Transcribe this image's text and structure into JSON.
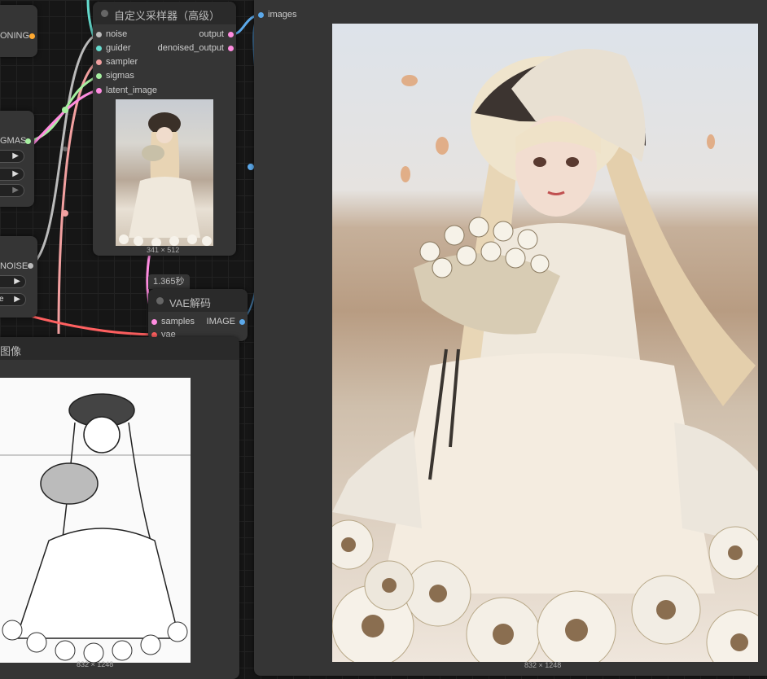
{
  "left_nodes": {
    "conditioning_out": "ONING",
    "sigmas_out": "GMAS",
    "noise_out": "NOISE",
    "widget_value": "e"
  },
  "sampler_node": {
    "title": "自定义采样器（高级）",
    "inputs": [
      "noise",
      "guider",
      "sampler",
      "sigmas",
      "latent_image"
    ],
    "outputs": [
      "output",
      "denoised_output"
    ],
    "preview_size": "341 × 512"
  },
  "vae_node": {
    "timing": "1.365秒",
    "title": "VAE解码",
    "input_samples": "samples",
    "input_vae": "vae",
    "output_image": "IMAGE"
  },
  "load_image_node": {
    "title": "图像",
    "image_size": "832 × 1248"
  },
  "preview_node": {
    "input_images": "images",
    "image_size": "832 × 1248"
  },
  "colors": {
    "guider": "#66ddd0",
    "sampler": "#f2a0a0",
    "sigmas": "#a6f0a0",
    "latent": "#ff8ce0",
    "image": "#5ca9ea",
    "vae": "#ff6060",
    "conditioning": "#ffa931",
    "noise": "#bbbbbb"
  }
}
